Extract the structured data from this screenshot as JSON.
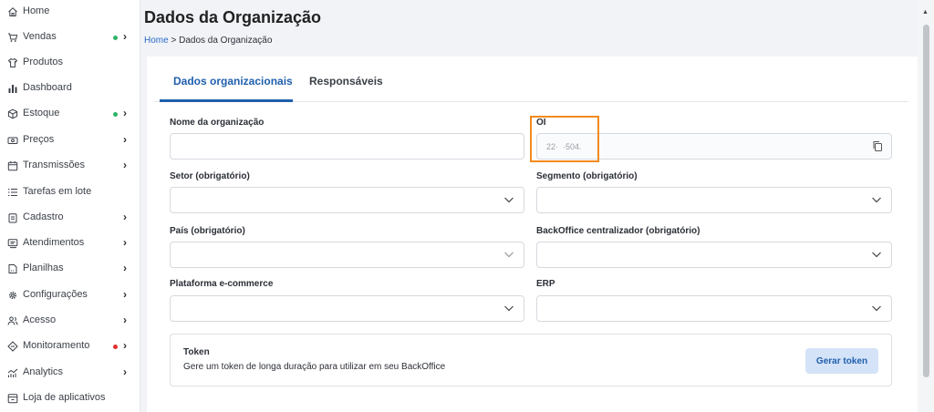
{
  "sidebar": {
    "items": [
      {
        "label": "Home",
        "icon": "home-icon",
        "dot": null,
        "chevron": false
      },
      {
        "label": "Vendas",
        "icon": "cart-icon",
        "dot": "#2fb36a",
        "chevron": true
      },
      {
        "label": "Produtos",
        "icon": "shirt-icon",
        "dot": null,
        "chevron": false
      },
      {
        "label": "Dashboard",
        "icon": "bar-chart-icon",
        "dot": null,
        "chevron": false
      },
      {
        "label": "Estoque",
        "icon": "box-icon",
        "dot": "#2fb36a",
        "chevron": true
      },
      {
        "label": "Preços",
        "icon": "price-tag-icon",
        "dot": null,
        "chevron": true
      },
      {
        "label": "Transmissões",
        "icon": "calendar-icon",
        "dot": null,
        "chevron": true
      },
      {
        "label": "Tarefas em lote",
        "icon": "list-icon",
        "dot": null,
        "chevron": false
      },
      {
        "label": "Cadastro",
        "icon": "clipboard-icon",
        "dot": null,
        "chevron": true
      },
      {
        "label": "Atendimentos",
        "icon": "chat-icon",
        "dot": null,
        "chevron": true
      },
      {
        "label": "Planilhas",
        "icon": "spreadsheet-icon",
        "dot": null,
        "chevron": true
      },
      {
        "label": "Configurações",
        "icon": "gear-icon",
        "dot": null,
        "chevron": true
      },
      {
        "label": "Acesso",
        "icon": "users-icon",
        "dot": null,
        "chevron": true
      },
      {
        "label": "Monitoramento",
        "icon": "diamond-icon",
        "dot": "#e0312b",
        "chevron": true
      },
      {
        "label": "Analytics",
        "icon": "analytics-icon",
        "dot": null,
        "chevron": true
      },
      {
        "label": "Loja de aplicativos",
        "icon": "store-icon",
        "dot": null,
        "chevron": false
      }
    ],
    "chevron_glyph": "›"
  },
  "header": {
    "title": "Dados da Organização",
    "breadcrumb": {
      "home": "Home",
      "separator": ">",
      "current": "Dados da Organização"
    }
  },
  "tabs": [
    {
      "label": "Dados organizacionais",
      "active": true
    },
    {
      "label": "Responsáveis",
      "active": false
    }
  ],
  "form": {
    "org_name": {
      "label": "Nome da organização",
      "value": ""
    },
    "oi": {
      "label": "OI",
      "value": "22·  ·504."
    },
    "setor": {
      "label": "Setor (obrigatório)",
      "value": ""
    },
    "segmento": {
      "label": "Segmento (obrigatório)",
      "value": ""
    },
    "pais": {
      "label": "País (obrigatório)",
      "value": ""
    },
    "backoffice": {
      "label": "BackOffice centralizador (obrigatório)",
      "value": ""
    },
    "plataforma": {
      "label": "Plataforma e-commerce",
      "value": ""
    },
    "erp": {
      "label": "ERP",
      "value": ""
    }
  },
  "token": {
    "title": "Token",
    "description": "Gere um token de longa duração para utilizar em seu BackOffice",
    "button_label": "Gerar token"
  },
  "colors": {
    "accent": "#1f5fad",
    "highlight": "#f28a1e",
    "status_green": "#2fb36a",
    "status_red": "#e0312b"
  }
}
